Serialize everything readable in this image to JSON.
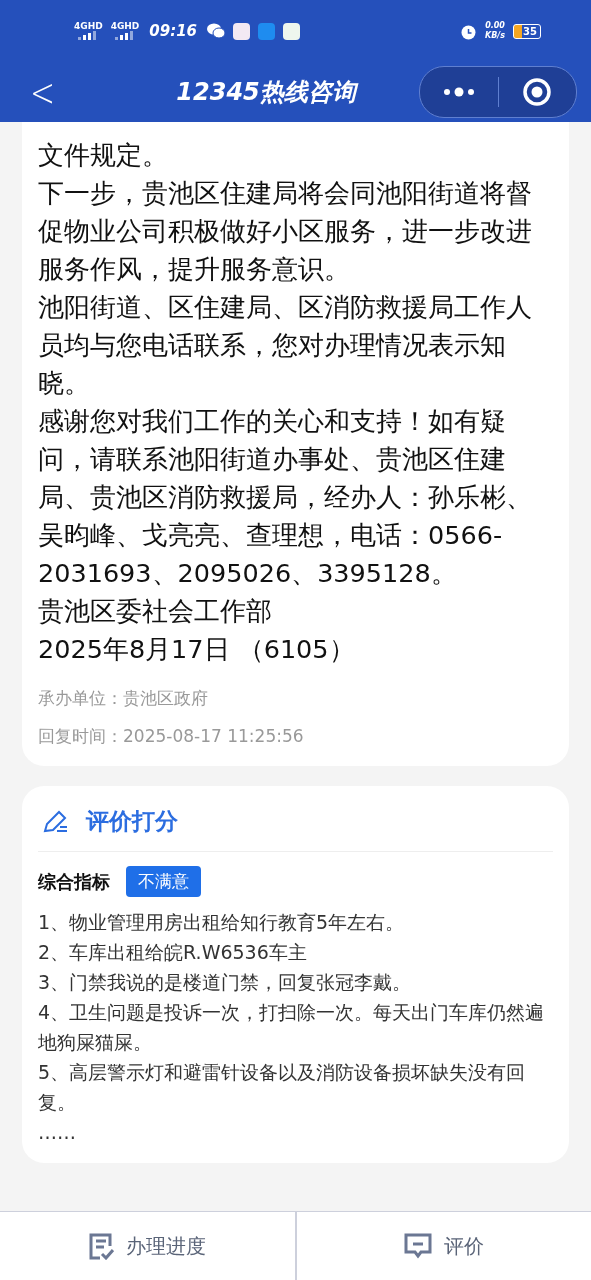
{
  "status_bar": {
    "network_1": "4GHD",
    "network_2": "4GHD",
    "time": "09:16",
    "speed": "0.00",
    "speed_unit": "KB/s",
    "battery": "35"
  },
  "nav": {
    "back": "<",
    "title": "12345热线咨询"
  },
  "reply": {
    "paragraphs": [
      "文件规定。",
      "下一步，贵池区住建局将会同池阳街道将督促物业公司积极做好小区服务，进一步改进服务作风，提升服务意识。",
      "池阳街道、区住建局、区消防救援局工作人员均与您电话联系，您对办理情况表示知晓。",
      "感谢您对我们工作的关心和支持！如有疑问，请联系池阳街道办事处、贵池区住建局、贵池区消防救援局，经办人：孙乐彬、吴昀峰、戈亮亮、查理想，电话：0566-2031693、2095026、3395128。",
      "贵池区委社会工作部",
      "2025年8月17日 （6105）"
    ],
    "meta": [
      {
        "label": "承办单位：",
        "value": "贵池区政府"
      },
      {
        "label": "回复时间：",
        "value": "2025-08-17 11:25:56"
      }
    ]
  },
  "rating": {
    "title": "评价打分",
    "indicator_label": "综合指标",
    "indicator_value": "不满意",
    "items": [
      "1、物业管理用房出租给知行教育5年左右。",
      "2、车库出租给皖R.W6536车主",
      "3、门禁我说的是楼道门禁，回复张冠李戴。",
      "4、卫生问题是投诉一次，打扫除一次。每天出门车库仍然遍地狗屎猫屎。",
      "5、高层警示灯和避雷针设备以及消防设备损坏缺失没有回复。",
      "……"
    ]
  },
  "bottom_bar": [
    {
      "kind": "progress",
      "label": "办理进度"
    },
    {
      "kind": "review",
      "label": "评价"
    }
  ]
}
